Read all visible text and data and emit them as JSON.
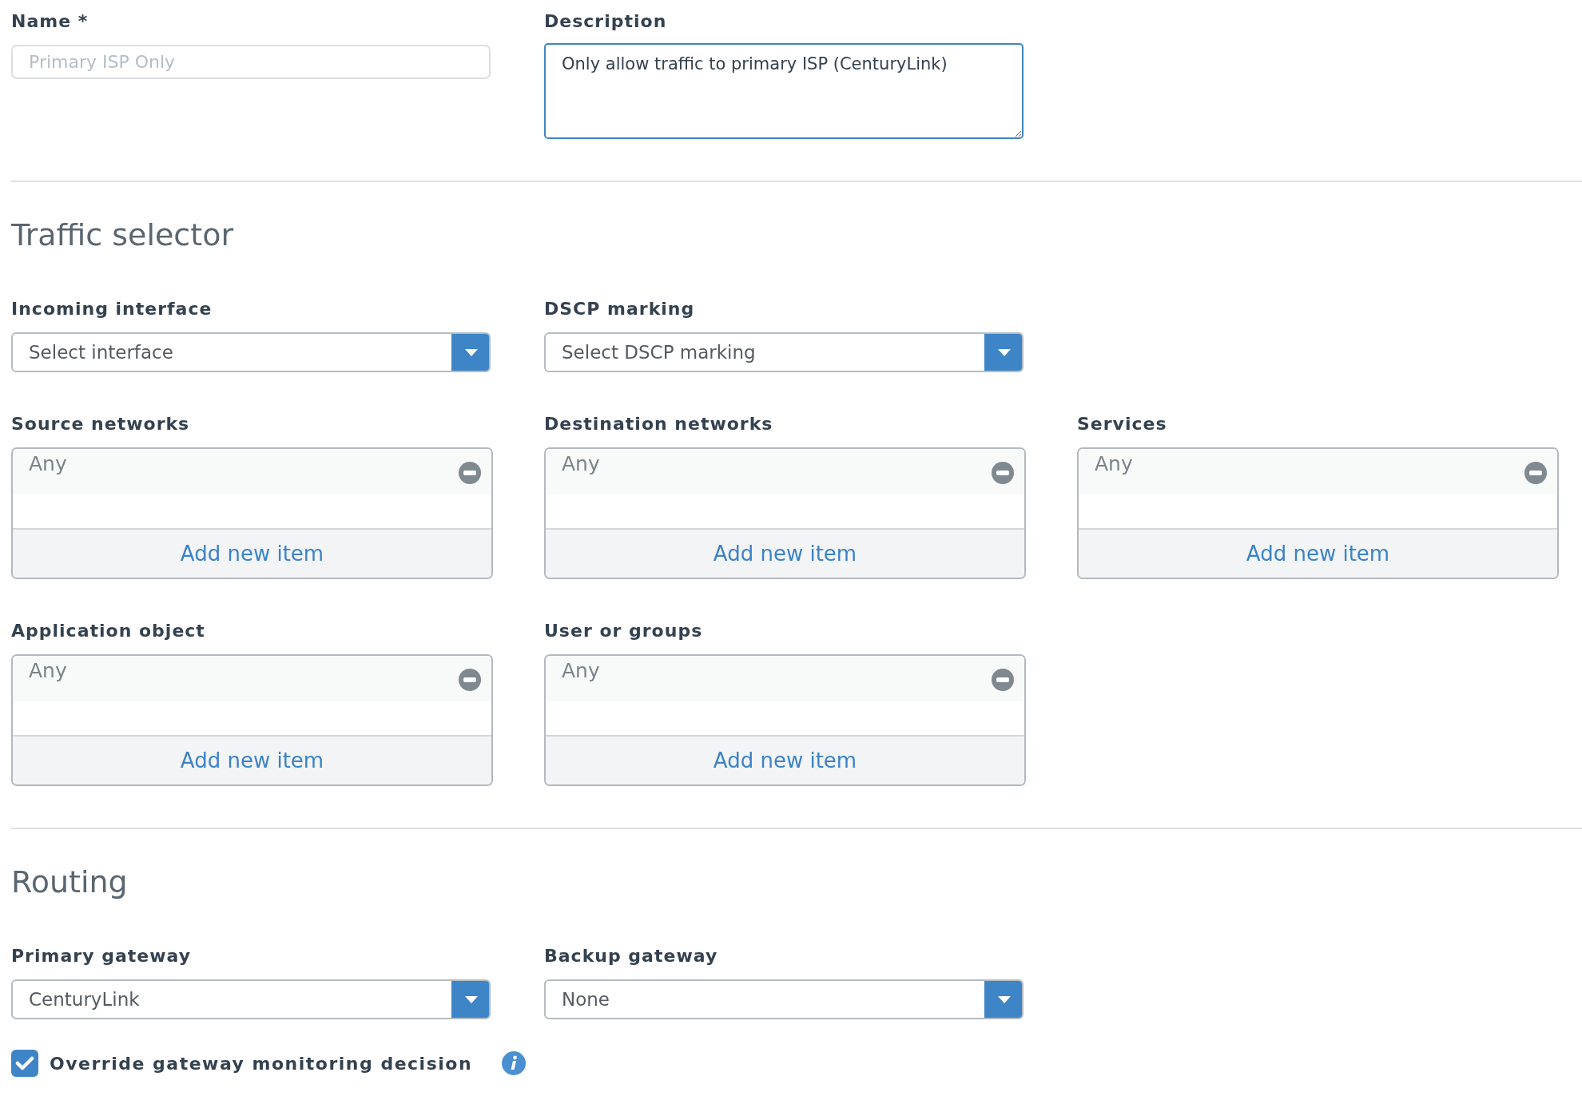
{
  "rows": [
    [
      {
        "kind": "text",
        "label": "Name *",
        "placeholder": "Primary ISP Only"
      },
      {
        "kind": "textarea",
        "label": "Description",
        "value": "Only allow traffic to primary ISP (CenturyLink)"
      }
    ]
  ],
  "sections": [
    {
      "title": "Traffic selector",
      "rows": [
        [
          {
            "kind": "select",
            "label": "Incoming interface",
            "value": "Select interface"
          },
          {
            "kind": "select",
            "label": "DSCP marking",
            "value": "Select DSCP marking"
          }
        ],
        [
          {
            "kind": "list",
            "label": "Source networks",
            "items": [
              "Any"
            ],
            "action": "Add new item"
          },
          {
            "kind": "list",
            "label": "Destination networks",
            "items": [
              "Any"
            ],
            "action": "Add new item"
          },
          {
            "kind": "list",
            "label": "Services",
            "items": [
              "Any"
            ],
            "action": "Add new item"
          }
        ],
        [
          {
            "kind": "list",
            "label": "Application object",
            "items": [
              "Any"
            ],
            "action": "Add new item"
          },
          {
            "kind": "list",
            "label": "User or groups",
            "items": [
              "Any"
            ],
            "action": "Add new item"
          }
        ]
      ]
    },
    {
      "title": "Routing",
      "rows": [
        [
          {
            "kind": "select",
            "label": "Primary gateway",
            "value": "CenturyLink"
          },
          {
            "kind": "select",
            "label": "Backup gateway",
            "value": "None"
          }
        ],
        [
          {
            "kind": "checkbox",
            "label": "Override gateway monitoring decision",
            "checked": true,
            "info": true
          }
        ]
      ]
    }
  ]
}
